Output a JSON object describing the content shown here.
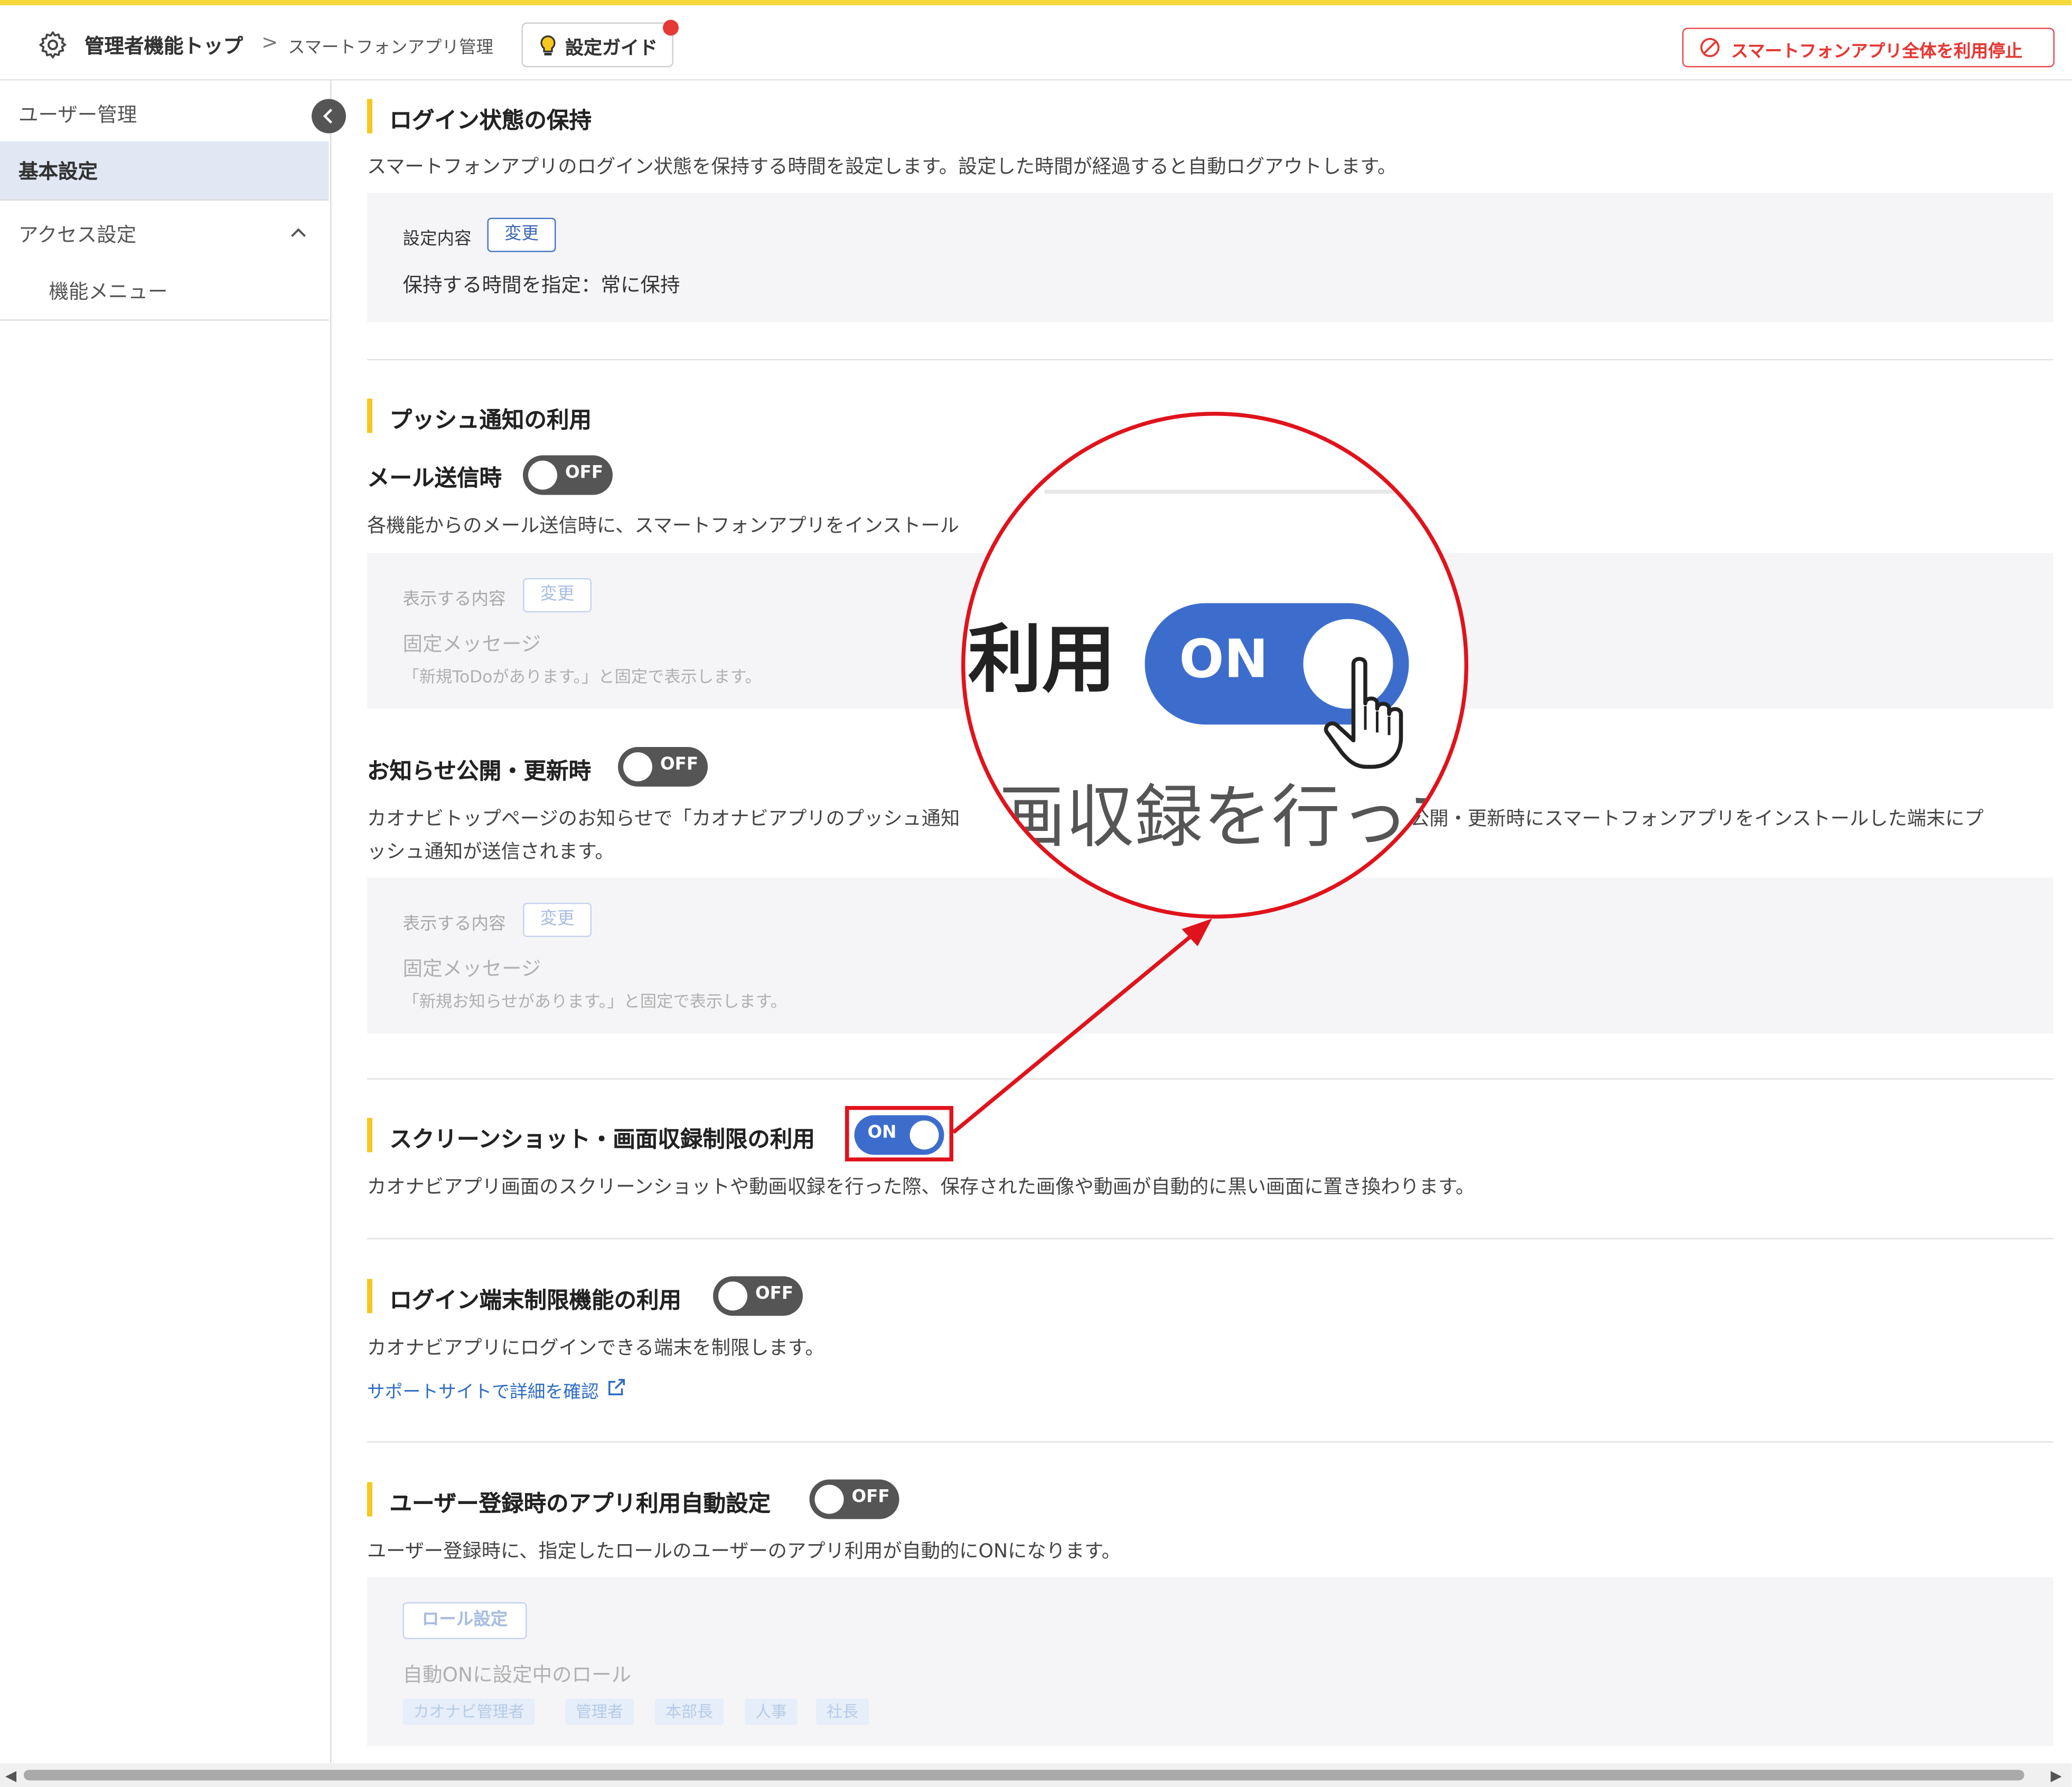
{
  "header": {
    "home": "管理者機能トップ",
    "separator": ">",
    "current": "スマートフォンアプリ管理",
    "guide_label": "設定ガイド",
    "stop_all_label": "スマートフォンアプリ全体を利用停止"
  },
  "sidebar": {
    "user_mgmt": "ユーザー管理",
    "basic_settings": "基本設定",
    "access_settings": "アクセス設定",
    "function_menu": "機能メニュー"
  },
  "login_keep": {
    "title": "ログイン状態の保持",
    "desc": "スマートフォンアプリのログイン状態を保持する時間を設定します。設定した時間が経過すると自動ログアウトします。",
    "content_label": "設定内容",
    "change": "変更",
    "value": "保持する時間を指定：常に保持"
  },
  "push": {
    "title": "プッシュ通知の利用",
    "mail_title": "メール送信時",
    "mail_toggle": "OFF",
    "mail_desc": "各機能からのメール送信時に、スマートフォンアプリをインストール",
    "mail_content_label": "表示する内容",
    "mail_change": "変更",
    "mail_value": "固定メッセージ",
    "mail_note": "「新規ToDoがあります。」と固定で表示します。",
    "news_title": "お知らせ公開・更新時",
    "news_toggle": "OFF",
    "news_desc_1a": "カオナビトップページのお知らせで「カオナビアプリのプッシュ通知",
    "news_desc_1b": "公開・更新時にスマートフォンアプリをインストールした端末にプ",
    "news_desc_2": "ッシュ通知が送信されます。",
    "news_content_label": "表示する内容",
    "news_change": "変更",
    "news_value": "固定メッセージ",
    "news_note": "「新規お知らせがあります。」と固定で表示します。"
  },
  "screenshot": {
    "title": "スクリーンショット・画面収録制限の利用",
    "toggle": "ON",
    "desc": "カオナビアプリ画面のスクリーンショットや動画収録を行った際、保存された画像や動画が自動的に黒い画面に置き換わります。"
  },
  "device_limit": {
    "title": "ログイン端末制限機能の利用",
    "toggle": "OFF",
    "desc": "カオナビアプリにログインできる端末を制限します。",
    "link": "サポートサイトで詳細を確認"
  },
  "auto_setting": {
    "title": "ユーザー登録時のアプリ利用自動設定",
    "toggle": "OFF",
    "desc": "ユーザー登録時に、指定したロールのユーザーのアプリ利用が自動的にONになります。",
    "role_button": "ロール設定",
    "roles_label": "自動ONに設定中のロール",
    "roles": [
      "カオナビ管理者",
      "管理者",
      "本部長",
      "人事",
      "社長"
    ]
  },
  "magnifier": {
    "text_top": "利用",
    "toggle": "ON",
    "text_bottom": "画収録を行った"
  },
  "colors": {
    "accent_blue": "#3d6dcc",
    "highlight_red": "#e0131c",
    "section_bar": "#f6c71c",
    "toggle_off": "#555555"
  }
}
